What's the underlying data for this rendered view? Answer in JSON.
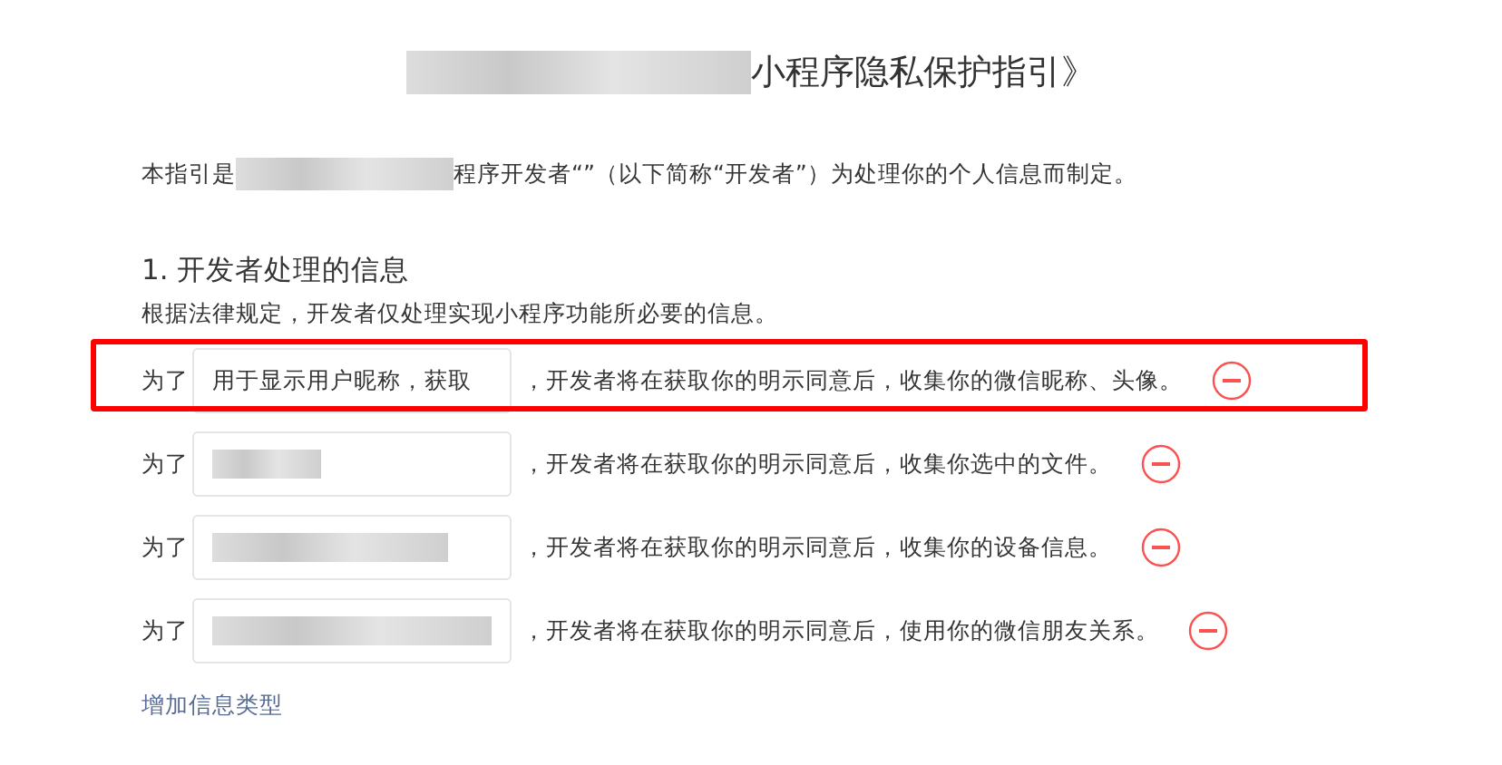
{
  "title": {
    "redacted_prefix": true,
    "text": "小程序隐私保护指引》"
  },
  "intro": {
    "before": "本指引是",
    "redacted": true,
    "after": "程序开发者“”（以下简称“开发者”）为处理你的个人信息而制定。"
  },
  "section": {
    "heading": "1. 开发者处理的信息",
    "note": "根据法律规定，开发者仅处理实现小程序功能所必要的信息。"
  },
  "rows": [
    {
      "prefix": "为了",
      "value": "用于显示用户昵称，获取",
      "redacted": false,
      "highlighted": true,
      "text": "，开发者将在获取你的明示同意后，收集你的微信昵称、头像。"
    },
    {
      "prefix": "为了",
      "redacted": true,
      "highlighted": false,
      "text": "，开发者将在获取你的明示同意后，收集你选中的文件。"
    },
    {
      "prefix": "为了",
      "redacted": true,
      "highlighted": false,
      "text": "，开发者将在获取你的明示同意后，收集你的设备信息。"
    },
    {
      "prefix": "为了",
      "redacted": true,
      "highlighted": false,
      "text": "，开发者将在获取你的明示同意后，使用你的微信朋友关系。"
    }
  ],
  "add_link": "增加信息类型"
}
